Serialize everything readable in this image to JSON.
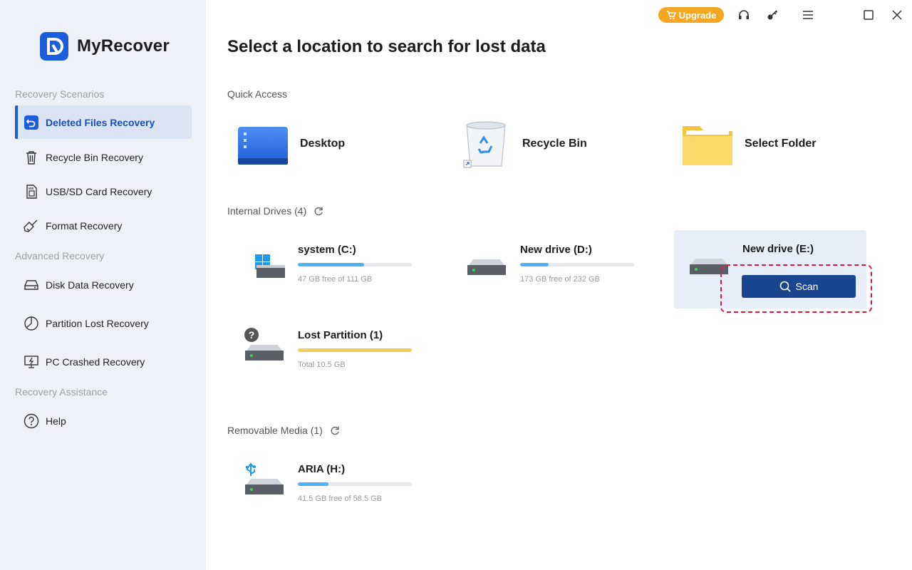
{
  "app": {
    "name": "MyRecover"
  },
  "titlebar": {
    "upgrade_label": "Upgrade"
  },
  "sidebar": {
    "sections": [
      {
        "title": "Recovery Scenarios"
      },
      {
        "title": "Advanced Recovery"
      },
      {
        "title": "Recovery Assistance"
      }
    ],
    "items": [
      {
        "label": "Deleted Files Recovery",
        "icon": "undo-file-icon",
        "active": true
      },
      {
        "label": "Recycle Bin Recovery",
        "icon": "trash-icon"
      },
      {
        "label": "USB/SD Card Recovery",
        "icon": "sd-card-icon"
      },
      {
        "label": "Format Recovery",
        "icon": "broom-icon"
      },
      {
        "label": "Disk Data Recovery",
        "icon": "disk-icon"
      },
      {
        "label": "Partition Lost Recovery",
        "icon": "partition-icon"
      },
      {
        "label": "PC Crashed Recovery",
        "icon": "monitor-icon"
      },
      {
        "label": "Help",
        "icon": "help-icon"
      }
    ]
  },
  "main": {
    "title": "Select a location to search for lost data",
    "quick_access": {
      "title": "Quick Access",
      "items": [
        {
          "label": "Desktop",
          "icon": "desktop-icon"
        },
        {
          "label": "Recycle Bin",
          "icon": "recycle-bin-icon"
        },
        {
          "label": "Select Folder",
          "icon": "folder-icon"
        }
      ]
    },
    "internal_drives": {
      "title": "Internal Drives (4)",
      "drives": [
        {
          "name": "system (C:)",
          "info": "47 GB free of 111 GB",
          "used_fraction": 0.58
        },
        {
          "name": "New drive (D:)",
          "info": "173 GB free of 232 GB",
          "used_fraction": 0.25
        },
        {
          "name": "New drive (E:)",
          "scan_label": "Scan"
        },
        {
          "name": "Lost Partition (1)",
          "info": "Total 10.5 GB",
          "used_fraction": 1.0
        }
      ]
    },
    "removable_media": {
      "title": "Removable Media (1)",
      "drives": [
        {
          "name": "ARIA (H:)",
          "info": "41.5 GB free of 58.5 GB",
          "used_fraction": 0.27
        }
      ]
    }
  },
  "colors": {
    "accent": "#1b5ddc",
    "scan_button": "#1a4690",
    "upgrade": "#f5a623",
    "highlight": "#e0173c"
  }
}
